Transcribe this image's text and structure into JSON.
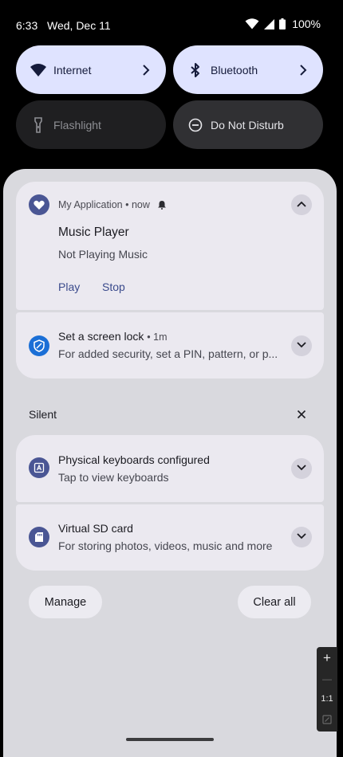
{
  "status_bar": {
    "time": "6:33",
    "date": "Wed, Dec 11",
    "battery": "100%",
    "icons": [
      "wifi-icon",
      "cell-signal-icon",
      "battery-icon"
    ]
  },
  "quick_settings": {
    "tiles": [
      {
        "label": "Internet",
        "state": "on",
        "icon": "wifi-icon"
      },
      {
        "label": "Bluetooth",
        "state": "on",
        "icon": "bluetooth-icon"
      },
      {
        "label": "Flashlight",
        "state": "off",
        "icon": "flashlight-icon"
      },
      {
        "label": "Do Not Disturb",
        "state": "off",
        "icon": "do-not-disturb-icon"
      }
    ]
  },
  "notifications": {
    "music": {
      "app_name": "My Application",
      "time": "now",
      "title": "Music Player",
      "text": "Not Playing Music",
      "actions": [
        "Play",
        "Stop"
      ]
    },
    "screen_lock": {
      "title": "Set a screen lock",
      "time": "1m",
      "text": "For added security, set a PIN, pattern, or p..."
    },
    "silent_label": "Silent",
    "keyboards": {
      "title": "Physical keyboards configured",
      "text": "Tap to view keyboards"
    },
    "sd_card": {
      "title": "Virtual SD card",
      "text": "For storing photos, videos, music and more"
    }
  },
  "footer": {
    "manage_label": "Manage",
    "clear_all_label": "Clear all"
  },
  "zoom_panel": {
    "plus": "+",
    "minus": "—",
    "ratio": "1:1"
  },
  "colors": {
    "tile_on": "#dfe3ff",
    "tile_off": "#1f1f21",
    "shade": "#d9d9de",
    "card": "#ebe9f0",
    "app_icon": "#4a5694",
    "shield_icon": "#1b6fd6"
  }
}
